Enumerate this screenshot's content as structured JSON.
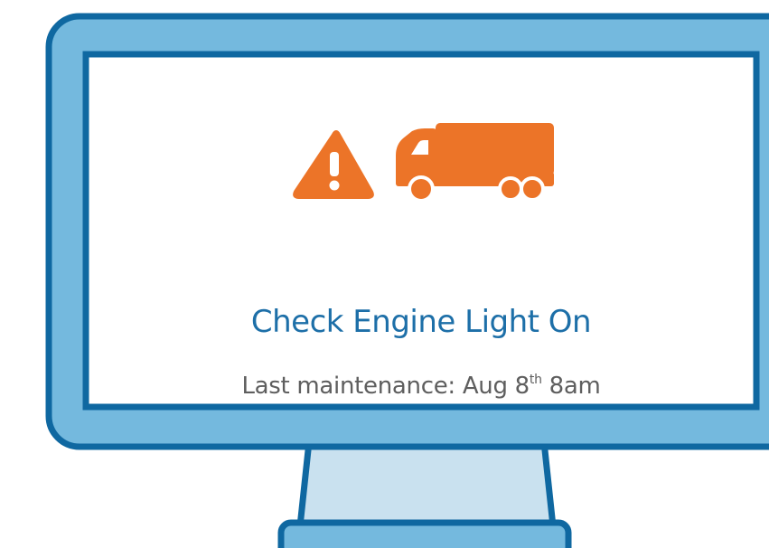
{
  "alert": {
    "title": "Check Engine Light On",
    "subtitle_prefix": "Last maintenance: Aug 8",
    "subtitle_suffix": "th",
    "subtitle_time": " 8am"
  },
  "icons": {
    "warning": "warning-triangle-icon",
    "vehicle": "truck-icon"
  },
  "colors": {
    "monitor_frame": "#74b9de",
    "monitor_outline": "#0f68a1",
    "stand": "#c9e1ef",
    "screen_bg": "#ffffff",
    "icon_orange": "#ec7428",
    "title_blue": "#1d6fa8",
    "subtitle_gray": "#5e5e5e"
  }
}
